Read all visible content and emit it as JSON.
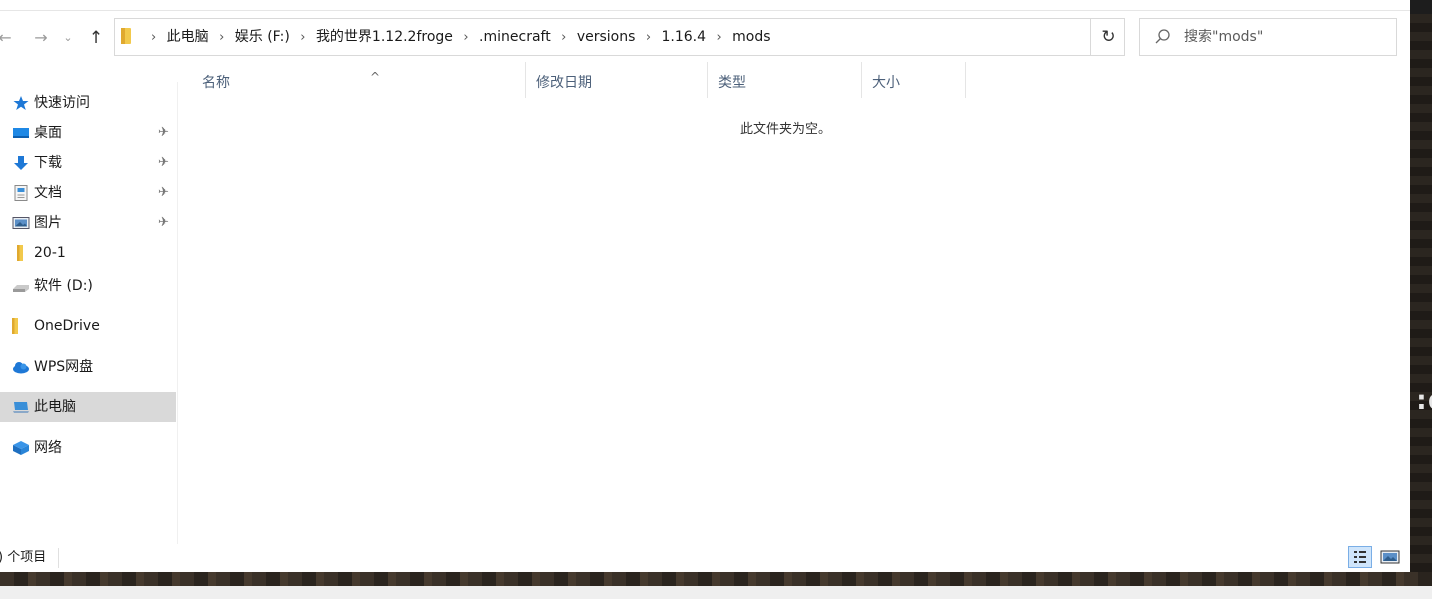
{
  "navigation": {
    "back": "←",
    "forward": "→",
    "recent": "⌄",
    "up": "↑"
  },
  "address": {
    "crumbs": [
      "此电脑",
      "娱乐 (F:)",
      "我的世界1.12.2froge",
      ".minecraft",
      "versions",
      "1.16.4",
      "mods"
    ],
    "separator": "›",
    "dropdown": "⌄",
    "refresh": "↻"
  },
  "search": {
    "placeholder": "搜索\"mods\""
  },
  "sidebar": {
    "items": [
      {
        "label": "快速访问",
        "icon": "star-icon",
        "pinned": false
      },
      {
        "label": "桌面",
        "icon": "desktop-icon",
        "pinned": true
      },
      {
        "label": "下载",
        "icon": "download-icon",
        "pinned": true
      },
      {
        "label": "文档",
        "icon": "document-icon",
        "pinned": true
      },
      {
        "label": "图片",
        "icon": "pictures-icon",
        "pinned": true
      },
      {
        "label": "20-1",
        "icon": "folder-icon",
        "pinned": false
      },
      {
        "label": "软件 (D:)",
        "icon": "drive-icon",
        "pinned": false
      },
      {
        "label": "OneDrive",
        "icon": "folder-icon",
        "pinned": false
      },
      {
        "label": "WPS网盘",
        "icon": "cloud-icon",
        "pinned": false
      },
      {
        "label": "此电脑",
        "icon": "computer-icon",
        "pinned": false,
        "selected": true
      },
      {
        "label": "网络",
        "icon": "network-icon",
        "pinned": false
      }
    ],
    "pin_glyph": "✈"
  },
  "columns": {
    "name": "名称",
    "date_modified": "修改日期",
    "type": "类型",
    "size": "大小",
    "sort_arrow": "^"
  },
  "content": {
    "empty_message": "此文件夹为空。"
  },
  "status": {
    "item_count": ") 个项目"
  },
  "game": {
    "letter": ":é"
  },
  "colors": {
    "selected_bg": "#d9d9d9",
    "header_text": "#4c607a",
    "folder_yellow": "#f2c94c",
    "accent_blue": "#1e78d6"
  }
}
